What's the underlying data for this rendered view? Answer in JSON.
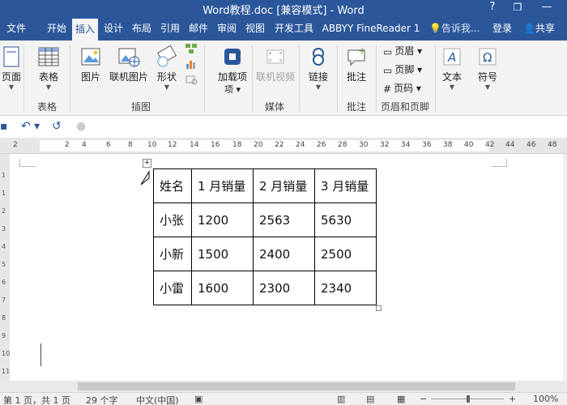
{
  "window": {
    "title": "Word教程.doc [兼容模式] - Word",
    "help": "?",
    "restore": "❐"
  },
  "tabs": [
    {
      "label": "文件"
    },
    {
      "label": "开始"
    },
    {
      "label": "插入",
      "active": true
    },
    {
      "label": "设计"
    },
    {
      "label": "布局"
    },
    {
      "label": "引用"
    },
    {
      "label": "邮件"
    },
    {
      "label": "审阅"
    },
    {
      "label": "视图"
    },
    {
      "label": "开发工具"
    },
    {
      "label": "ABBYY FineReader 1"
    }
  ],
  "tell_me": "告诉我...",
  "account": {
    "login": "登录",
    "share": "共享"
  },
  "ribbon": {
    "page": "页面",
    "table": "表格",
    "pictures": "图片",
    "online_pictures": "联机图片",
    "shapes": "形状",
    "addins": "加载项",
    "online_video": "联机视频",
    "link": "链接",
    "comment": "批注",
    "header": "页眉",
    "footer": "页脚",
    "page_number": "页码",
    "text": "文本",
    "symbol": "符号",
    "groups": {
      "table": "表格",
      "illustrations": "插图",
      "media": "媒体",
      "comments": "批注",
      "header_footer": "页眉和页脚"
    }
  },
  "ruler_ticks": [
    "2",
    "2",
    "4",
    "6",
    "8",
    "10",
    "12",
    "14",
    "16",
    "18",
    "20",
    "22",
    "24",
    "26",
    "28",
    "30",
    "32",
    "34",
    "36",
    "38",
    "40",
    "42",
    "44",
    "46",
    "48"
  ],
  "vruler_ticks": [
    "1",
    "1",
    "2",
    "3",
    "4",
    "5",
    "6",
    "7",
    "8",
    "9",
    "10",
    "11"
  ],
  "table": {
    "rows": [
      [
        "姓名",
        "1 月销量",
        "2 月销量",
        "3 月销量"
      ],
      [
        "小张",
        "1200",
        "2563",
        "5630"
      ],
      [
        "小新",
        "1500",
        "2400",
        "2500"
      ],
      [
        "小雷",
        "1600",
        "2300",
        "2340"
      ]
    ]
  },
  "status": {
    "page": "第 1 页，共 1 页",
    "words": "29 个字",
    "language": "中文(中国)",
    "zoom": "100%"
  },
  "colors": {
    "accent": "#2b579a",
    "ribbon_bg": "#f3f3f3"
  }
}
